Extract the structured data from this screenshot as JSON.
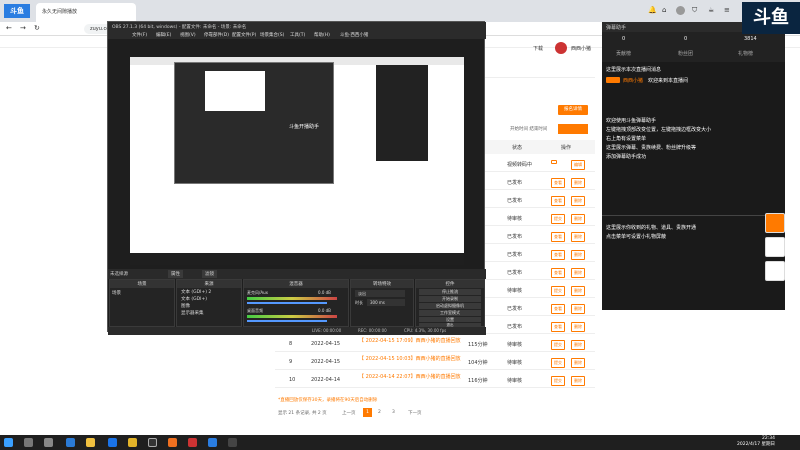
{
  "browser": {
    "tab_title": "永久无间隙播放",
    "url": "zuyu.com",
    "download_label": "下载",
    "user_label": "西西小猪"
  },
  "page": {
    "header_status": "状态",
    "header_action": "操作",
    "filter_label": "开始时间 结束时间",
    "orange_top_btn": "报名详情",
    "rows": [
      {
        "idx": "",
        "date": "",
        "title": "",
        "dur": "",
        "status": "视频转码中",
        "a1": "",
        "a2": "编辑"
      },
      {
        "idx": "",
        "date": "",
        "title": "",
        "dur": "",
        "status": "已发布",
        "a1": "查看",
        "a2": "删除"
      },
      {
        "idx": "",
        "date": "",
        "title": "",
        "dur": "",
        "status": "已发布",
        "a1": "查看",
        "a2": "删除"
      },
      {
        "idx": "",
        "date": "",
        "title": "",
        "dur": "",
        "status": "待审核",
        "a1": "提交",
        "a2": "删除"
      },
      {
        "idx": "",
        "date": "",
        "title": "",
        "dur": "",
        "status": "已发布",
        "a1": "查看",
        "a2": "删除"
      },
      {
        "idx": "",
        "date": "",
        "title": "",
        "dur": "",
        "status": "已发布",
        "a1": "查看",
        "a2": "删除"
      },
      {
        "idx": "",
        "date": "",
        "title": "",
        "dur": "",
        "status": "已发布",
        "a1": "查看",
        "a2": "删除"
      },
      {
        "idx": "",
        "date": "",
        "title": "",
        "dur": "",
        "status": "待审核",
        "a1": "提交",
        "a2": "删除"
      },
      {
        "idx": "",
        "date": "",
        "title": "",
        "dur": "",
        "status": "已发布",
        "a1": "查看",
        "a2": "删除"
      },
      {
        "idx": "",
        "date": "",
        "title": "",
        "dur": "",
        "status": "已发布",
        "a1": "查看",
        "a2": "删除"
      },
      {
        "idx": "8",
        "date": "2022-04-15",
        "title": "【 2022-04-15 17:09】西西小猪的直播回放",
        "dur": "115分钟",
        "status": "待审核",
        "a1": "提交",
        "a2": "删除"
      },
      {
        "idx": "9",
        "date": "2022-04-15",
        "title": "【 2022-04-15 10:03】西西小猪的直播回放",
        "dur": "104分钟",
        "status": "待审核",
        "a1": "提交",
        "a2": "删除"
      },
      {
        "idx": "10",
        "date": "2022-04-14",
        "title": "【 2022-04-14 22:07】西西小猪的直播回放",
        "dur": "116分钟",
        "status": "待审核",
        "a1": "提交",
        "a2": "删除"
      }
    ],
    "footnote": "*直播回放仅保存30天，录播将在90天后自动删除",
    "pagination": {
      "summary": "显示 21 条记录, 共 2 页",
      "prev": "上一页",
      "p1": "1",
      "p2": "2",
      "p3": "3",
      "next": "下一页"
    }
  },
  "obs": {
    "title": "OBS 27.1.3 (64 bit, windows) - 配置文件: 未命名 - 场景: 未命名",
    "menu": [
      "文件(F)",
      "编辑(E)",
      "视图(V)",
      "停靠部件(D)",
      "配置文件(P)",
      "场景集合(S)",
      "工具(T)",
      "帮助(H)",
      "斗鱼·西西小猪"
    ],
    "preview_text": "斗鱼开播助手",
    "scene_label": "未选择源",
    "props_btn": "属性",
    "filter_btn": "滤镜",
    "docks": {
      "scenes": "场景",
      "sources": "来源",
      "mixer": "混音器",
      "transitions": "转场特效",
      "controls": "控件"
    },
    "scene_items": [
      "场景"
    ],
    "source_items": [
      "文本 (GDI+) 2",
      "文本 (GDI+)",
      "图像",
      "显示器采集"
    ],
    "mixer": {
      "desktop": "桌面音频",
      "mic": "麦克风/Aux",
      "db1": "0.0 dB",
      "db2": "0.0 dB"
    },
    "transition": {
      "type": "淡出",
      "dur_label": "时长",
      "dur": "300 ms"
    },
    "controls": [
      "停止推流",
      "开始录制",
      "启动虚拟摄像机",
      "工作室模式",
      "设置",
      "退出"
    ],
    "status": {
      "live": "LIVE: 00:00:00",
      "rec": "REC: 00:00:00",
      "cpu": "CPU: 4.3%, 30.00 fps"
    }
  },
  "chat": {
    "title": "弹幕助手",
    "stats": [
      "0",
      "0",
      "3814"
    ],
    "stat_labels": [
      "贡献榜",
      "粉丝团",
      "礼物榜"
    ],
    "line1": "这里展示本次直播间消息",
    "line2_user": "西西小猪",
    "line2_text": "欢迎来到本直播间",
    "guide_title": "欢迎使用斗鱼弹幕助手",
    "guide_lines": [
      "左键拖拽顶部改变位置，左键拖拽边框改变大小",
      "右上角有设置菜单",
      "这里展示弹幕、贵族续费、粉丝牌升级等",
      "添加弹幕助手成功"
    ],
    "gift_lines": [
      "这里展示你收到的礼物、道具、贵族开通",
      "点击菜单可设置小礼物屏蔽"
    ]
  },
  "taskbar": {
    "time": "22:34",
    "date": "2022/4/17 星期日"
  },
  "colors": {
    "accent": "#ff7a00",
    "obs_bg": "#1e1e1e",
    "chat_bg": "#1a1a1a"
  }
}
